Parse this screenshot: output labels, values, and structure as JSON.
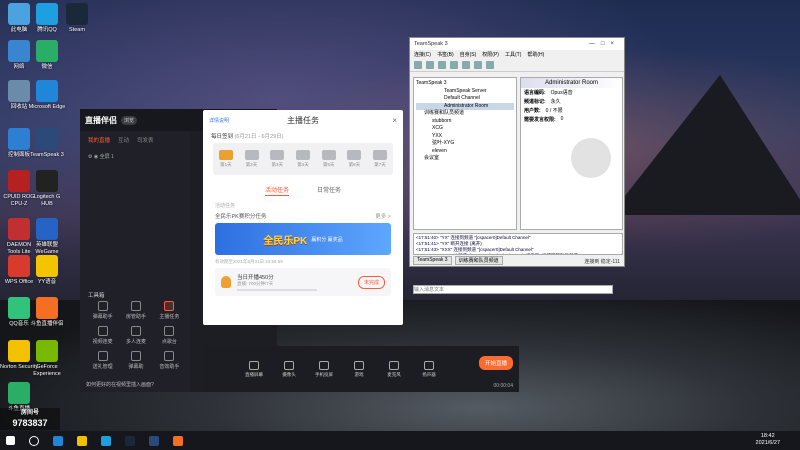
{
  "desktop": {
    "icons": [
      {
        "label": "此电脑",
        "color": "#4aa3df"
      },
      {
        "label": "腾讯QQ",
        "color": "#1ea0e0"
      },
      {
        "label": "Steam",
        "color": "#1b2838"
      },
      {
        "label": "网络",
        "color": "#3a85cf"
      },
      {
        "label": "微信",
        "color": "#2aae67"
      },
      {
        "label": "回收站",
        "color": "#6a8caa"
      },
      {
        "label": "Microsoft Edge",
        "color": "#1f86d9"
      },
      {
        "label": "控制面板",
        "color": "#2d7fd3"
      },
      {
        "label": "TeamSpeak 3",
        "color": "#2b4a7a"
      },
      {
        "label": "CPUID ROG CPU-Z",
        "color": "#b52020"
      },
      {
        "label": "Logitech G HUB",
        "color": "#222"
      },
      {
        "label": "DAEMON Tools Lite",
        "color": "#c03030"
      },
      {
        "label": "英雄联盟WeGame",
        "color": "#2563c4"
      },
      {
        "label": "WPS Office",
        "color": "#d83a2e"
      },
      {
        "label": "YY语音",
        "color": "#f5c400"
      },
      {
        "label": "QQ音乐",
        "color": "#31c27c"
      },
      {
        "label": "斗鱼直播伴侣",
        "color": "#f46f23"
      },
      {
        "label": "Norton Security",
        "color": "#f2c200"
      },
      {
        "label": "GeForce Experience",
        "color": "#76b900"
      },
      {
        "label": "斗鱼直播",
        "color": "#2aae67"
      }
    ]
  },
  "app": {
    "title": "直播伴侣",
    "badge": "浏览",
    "tabs": [
      "我的直播",
      "互动",
      "司发表"
    ],
    "active_tab": "我的直播",
    "tool_section": "工具箱",
    "tools": [
      {
        "label": "弹幕助手",
        "hot": false
      },
      {
        "label": "房管助手",
        "hot": false
      },
      {
        "label": "主播任务",
        "hot": true
      },
      {
        "label": "视频连麦",
        "hot": false
      },
      {
        "label": "多人连麦",
        "hot": false
      },
      {
        "label": "点歌台",
        "hot": false
      },
      {
        "label": "送礼管理",
        "hot": false
      },
      {
        "label": "弹幕助",
        "hot": false
      },
      {
        "label": "音效助手",
        "hot": false
      }
    ],
    "notice": "如何更好的在视频里插入画面?"
  },
  "task_panel": {
    "title": "主播任务",
    "rule_link": "详情说明",
    "signin_label": "每日签到",
    "signin_sub": "(6月21日 - 6月29日)",
    "days": [
      "第1天",
      "第2天",
      "第3天",
      "第4天",
      "第5天",
      "第6天",
      "第7天"
    ],
    "tabs": [
      "活动任务",
      "日常任务"
    ],
    "active_tab": "活动任务",
    "section_label": "活动任务",
    "pk_title": "全民乐PK赛积分任务",
    "pk_more": "更多 >",
    "pk_banner_big": "全民乐PK",
    "pk_banner_small": "赢积分 赢奖品",
    "deadline": "有效期至2021年8月31日 23:59:59",
    "duty_title": "当日开播450分",
    "duty_sub": "直播: 700分钟/7天",
    "duty_button": "未完成"
  },
  "toolbar": {
    "items": [
      "直播屏幕",
      "摄像头",
      "手机投屏",
      "游戏",
      "麦克风",
      "扬声器"
    ],
    "start_label": "开始直播",
    "timer": "00:00:04"
  },
  "teamspeak": {
    "window_title": "TeamSpeak 3",
    "menu": [
      "连接(C)",
      "书签(B)",
      "自身(S)",
      "权限(P)",
      "工具(T)",
      "帮助(H)"
    ],
    "tree": [
      "TeamSpeak 3",
      "TeamSpeak Server",
      "Default Channel",
      "Administrator Room",
      "训练赛和队员频道",
      "stubborn",
      "XCG",
      "YXX",
      "弦叶-XYG",
      "eleven",
      "会议室"
    ],
    "info_header": "Administrator Room",
    "info": [
      {
        "k": "语言编码:",
        "v": "Opus语音"
      },
      {
        "k": "频道标记:",
        "v": "永久"
      },
      {
        "k": "用户数:",
        "v": "0 / 不限"
      },
      {
        "k": "需要发言权限:",
        "v": "0"
      }
    ],
    "log": [
      "<17:51:40> \"YX\" 连接到频道 \"[cspacer0]Default Channel\"",
      "<17:51:41> \"YX\" 断开连接 (离开)",
      "<17:51:43> \"XXX\" 连接到频道 \"[cspacer0]Default Channel\"",
      "<17:51:43> \"XXX\" 从频道 \"[cspacer0]Default Channel\" 切换到 \"训练赛和队员频道\""
    ],
    "tabs": [
      "TeamSpeak 3",
      "训练赛和队员频道"
    ],
    "input_placeholder": "输入消息文本",
    "status": "连接到 稳定-111"
  },
  "taskbar": {
    "time": "18:42",
    "date": "2021/6/27"
  },
  "watermark": {
    "room_label": "房间号",
    "room_number": "9783837"
  }
}
